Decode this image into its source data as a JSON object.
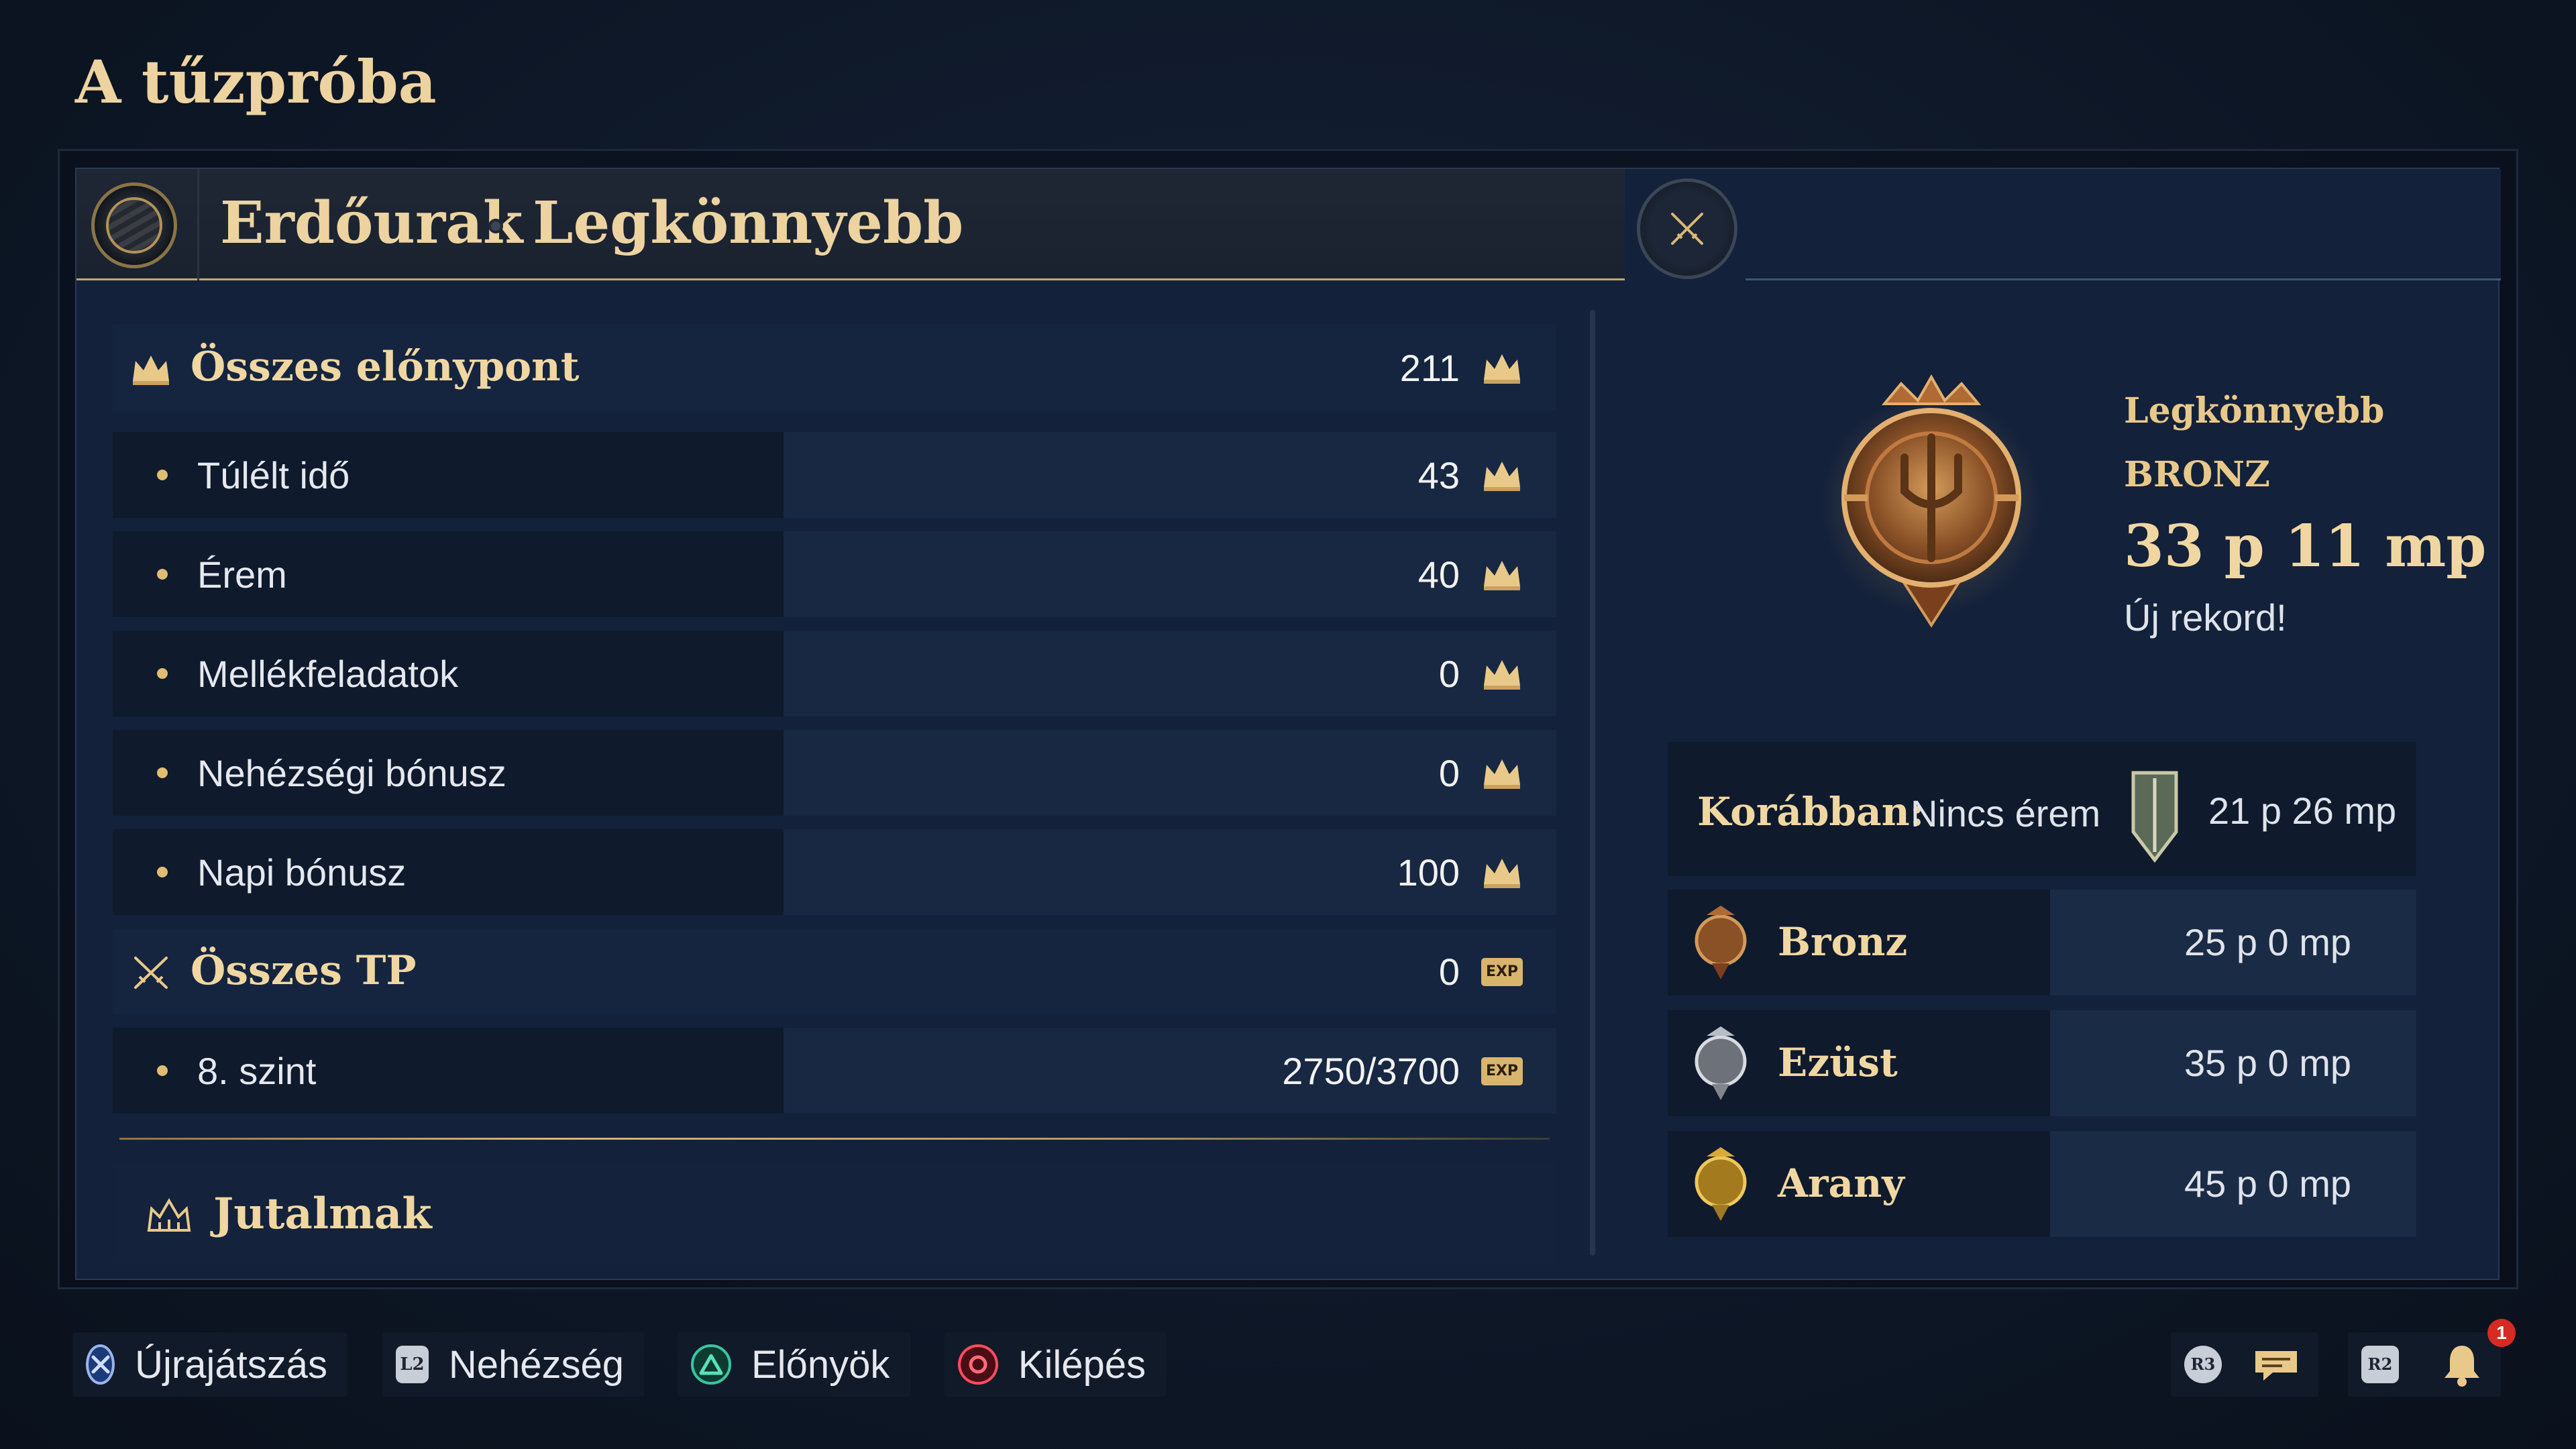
{
  "page_title": "A tűzpróba",
  "header": {
    "mode": "Erdőurak",
    "difficulty": "Legkönnyebb"
  },
  "stats": {
    "total_points": {
      "label": "Összes előnypont",
      "value": "211"
    },
    "rows": [
      {
        "label": "Túlélt idő",
        "value": "43"
      },
      {
        "label": "Érem",
        "value": "40"
      },
      {
        "label": "Mellékfeladatok",
        "value": "0"
      },
      {
        "label": "Nehézségi bónusz",
        "value": "0"
      },
      {
        "label": "Napi bónusz",
        "value": "100"
      }
    ],
    "total_tp": {
      "label": "Összes TP",
      "value": "0"
    },
    "level": {
      "label": "8. szint",
      "value": "2750/3700"
    },
    "exp_badge": "EXP",
    "level_progress": 0.743,
    "rewards_label": "Jutalmak"
  },
  "result": {
    "difficulty": "Legkönnyebb",
    "rank": "BRONZ",
    "time": "33 p 11 mp",
    "note": "Új rekord!",
    "previous": {
      "label": "Korábban:",
      "medal": "Nincs érem",
      "time": "21 p 26 mp"
    },
    "tiers": [
      {
        "name": "Bronz",
        "time": "25 p 0 mp",
        "color": "#b8753f"
      },
      {
        "name": "Ezüst",
        "time": "35 p 0 mp",
        "color": "#b9bec6"
      },
      {
        "name": "Arany",
        "time": "45 p 0 mp",
        "color": "#d9a93a"
      }
    ]
  },
  "footer": {
    "buttons": [
      {
        "label": "Újrajátszás",
        "icon": "cross-button-icon",
        "color": "#7f9fe0"
      },
      {
        "label": "Nehézség",
        "icon": "l2-button-icon",
        "glyph": "L2"
      },
      {
        "label": "Előnyök",
        "icon": "triangle-button-icon",
        "color": "#39c6a0"
      },
      {
        "label": "Kilépés",
        "icon": "circle-button-icon",
        "color": "#ff4d5e"
      }
    ],
    "right_icons": {
      "r3": "R3",
      "r2": "R2",
      "notification_count": "1"
    }
  },
  "colors": {
    "accent_gold": "#e9c98a",
    "panel": "#13213a",
    "row_dark": "#0f1a2d"
  }
}
